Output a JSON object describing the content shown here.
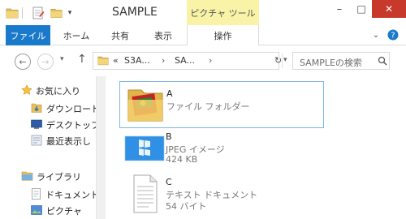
{
  "window": {
    "title": "SAMPLE"
  },
  "context_tab": {
    "group": "ピクチャ ツール",
    "tab": "操作"
  },
  "ribbon": {
    "file": "ファイル",
    "tabs": [
      "ホーム",
      "共有",
      "表示"
    ]
  },
  "window_controls": {
    "minimize": "–",
    "maximize": "□",
    "close": "✕"
  },
  "address": {
    "prefix": "«",
    "segments": [
      "S3A...",
      "SA..."
    ],
    "separator": "›"
  },
  "search": {
    "placeholder": "SAMPLEの検索"
  },
  "nav": {
    "favorites": "お気に入り",
    "favorite_items": [
      "ダウンロード",
      "デスクトップ",
      "最近表示し"
    ],
    "library": "ライブラリ",
    "library_items": [
      "ドキュメント",
      "ピクチャ"
    ]
  },
  "files": [
    {
      "name": "A",
      "type": "ファイル フォルダー",
      "size": "",
      "icon": "folder-icon",
      "selected": true
    },
    {
      "name": "B",
      "type": "JPEG イメージ",
      "size": "424 KB",
      "icon": "image-icon",
      "selected": false
    },
    {
      "name": "C",
      "type": "テキスト ドキュメント",
      "size": "54 バイト",
      "icon": "text-document-icon",
      "selected": false
    }
  ],
  "colors": {
    "file_tab": "#1979ca",
    "context_tab": "#f8f3a6",
    "selection_border": "#7fb5e6"
  }
}
